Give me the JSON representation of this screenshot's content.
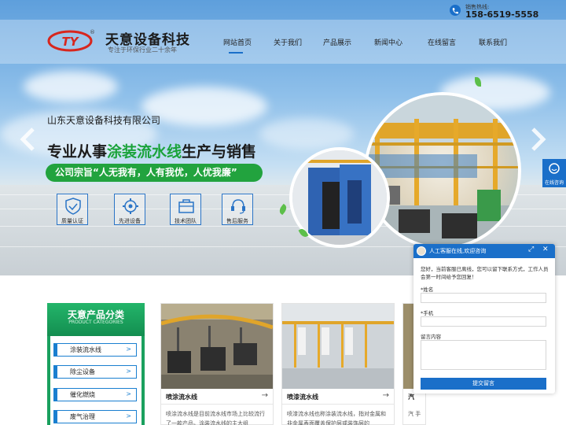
{
  "header": {
    "logo_mark": "TY",
    "logo_reg": "®",
    "company_name": "天意设备科技",
    "tagline": "专注于环保行业二十余年",
    "hotline_label": "销售热线:",
    "hotline_number": "158-6519-5558",
    "nav": [
      {
        "label": "网站首页",
        "active": true
      },
      {
        "label": "关于我们"
      },
      {
        "label": "产品展示"
      },
      {
        "label": "新闻中心"
      },
      {
        "label": "在线留言"
      },
      {
        "label": "联系我们"
      }
    ]
  },
  "banner": {
    "company": "山东天意设备科技有限公司",
    "slogan_pre": "专业从事",
    "slogan_highlight": "涂装流水线",
    "slogan_post": "生产与销售",
    "motto": "公司宗旨“人无我有，人有我优，人优我廉”",
    "features": [
      {
        "icon": "shield-check-icon",
        "label": "质量认证"
      },
      {
        "icon": "gear-icon",
        "label": "先进设备"
      },
      {
        "icon": "briefcase-icon",
        "label": "技术团队"
      },
      {
        "icon": "service-icon",
        "label": "售后服务"
      }
    ]
  },
  "categories": {
    "title": "天意产品分类",
    "title_en": "PRODUCT CATEGORIES",
    "items": [
      {
        "label": "涂装流水线",
        "arrow": ">"
      },
      {
        "label": "除尘设备",
        "arrow": ">"
      },
      {
        "label": "催化燃烧",
        "arrow": ">"
      },
      {
        "label": "废气治理",
        "arrow": ">"
      }
    ]
  },
  "products": [
    {
      "name": "喷涂流水线",
      "arrow": "→",
      "desc": "喷涂流水线是目前流水线市场上比较流行了一款产品，涂装流水线的主大组"
    },
    {
      "name": "喷漆流水线",
      "arrow": "→",
      "desc": "喷漆流水线也称涂装流水线，指对金属和非金属表面覆盖保护层或装饰层的"
    },
    {
      "name": "汽",
      "arrow": "",
      "desc": "汽 手"
    }
  ],
  "side_tab": {
    "label": "在线咨询",
    "icon": "chat-bubble-icon"
  },
  "chat": {
    "title": "人工客服在线,欢迎咨询",
    "minimize": "⤢",
    "close": "✕",
    "message": "您好，当前客服已离线，您可以留下联系方式，工作人员会第一时间给予您回复！",
    "name_label": "*姓名",
    "phone_label": "*手机",
    "message_label": "留言内容",
    "submit_label": "提交留言"
  },
  "colors": {
    "brand_blue": "#1a6fc9",
    "brand_green": "#22a33e",
    "logo_red": "#d7261e"
  }
}
